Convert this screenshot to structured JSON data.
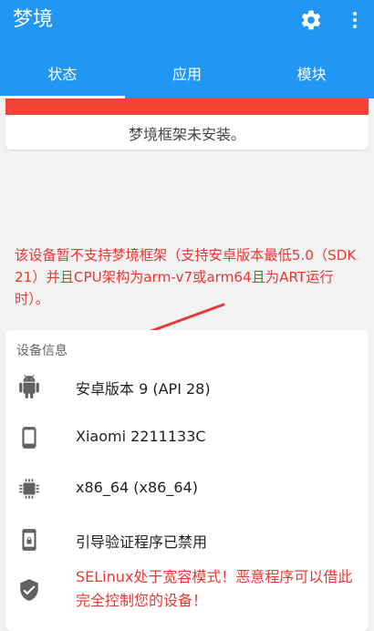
{
  "app": {
    "title": "梦境",
    "settings_icon": "gear-icon",
    "more_icon": "more-vert-icon",
    "bar_color": "#2196f3"
  },
  "tabs": [
    {
      "label": "状态",
      "active": true
    },
    {
      "label": "应用",
      "active": false
    },
    {
      "label": "模块",
      "active": false
    }
  ],
  "status": {
    "message": "梦境框架未安装。",
    "status_color": "#f44336"
  },
  "warning": {
    "text": "该设备暂不支持梦境框架（支持安卓版本最低5.0（SDK 21）并且CPU架构为arm-v7或arm64且为ART运行时）。",
    "color": "#e53935"
  },
  "device_info": {
    "section_title": "设备信息",
    "items": [
      {
        "icon": "android-icon",
        "text": "安卓版本 9 (API 28)"
      },
      {
        "icon": "phone-icon",
        "text": "Xiaomi 2211133C"
      },
      {
        "icon": "chip-icon",
        "text": "x86_64 (x86_64)"
      },
      {
        "icon": "phone-lock-icon",
        "text": "引导验证程序已禁用"
      },
      {
        "icon": "shield-icon",
        "text": "SELinux处于宽容模式！恶意程序可以借此完全控制您的设备！",
        "warning": true
      }
    ]
  }
}
